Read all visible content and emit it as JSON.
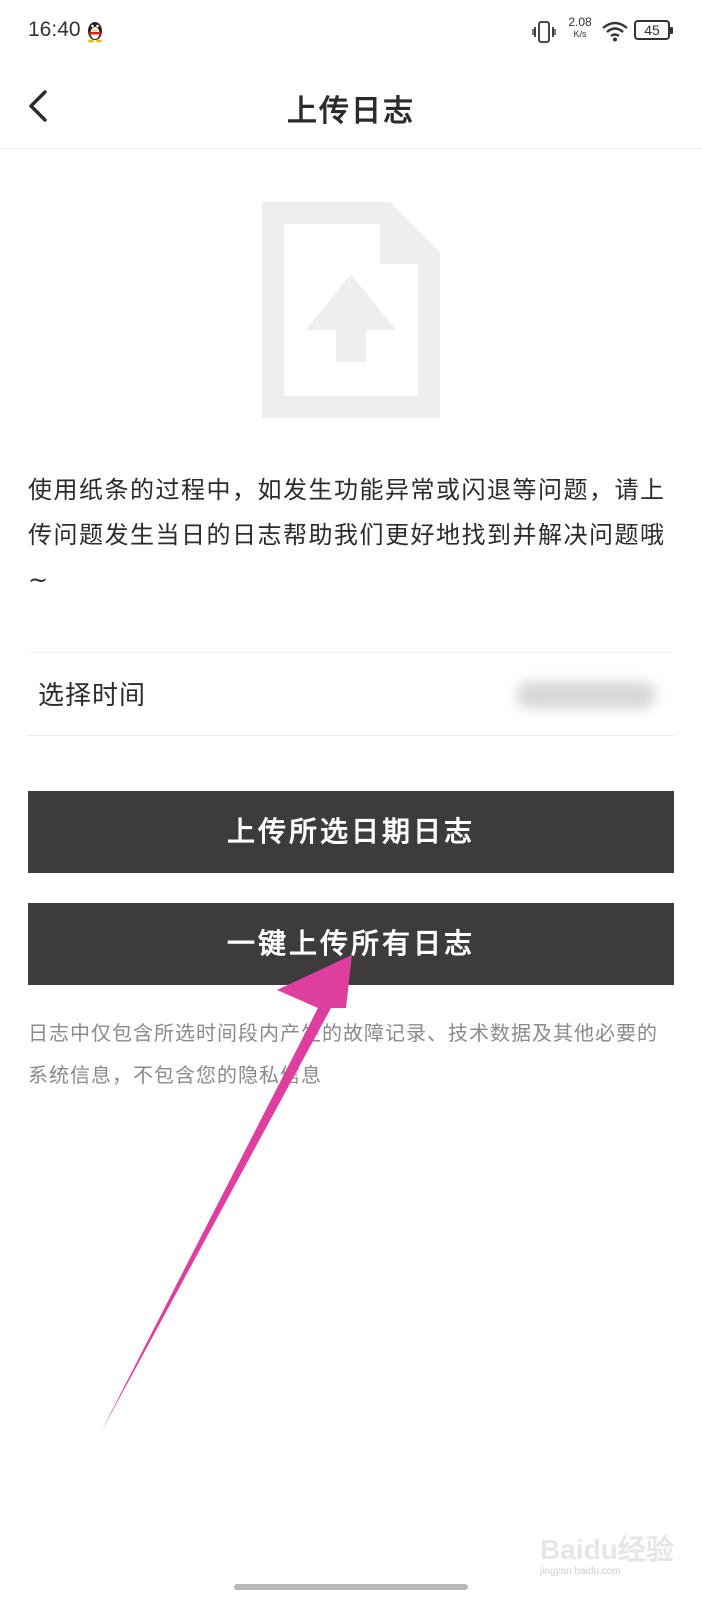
{
  "status_bar": {
    "time": "16:40",
    "net_speed_value": "2.08",
    "net_speed_unit": "K/s",
    "battery_level": "45",
    "icons": [
      "qq-penguin-icon",
      "vibrate-icon",
      "wifi-icon",
      "battery-icon"
    ]
  },
  "header": {
    "title": "上传日志",
    "back_icon": "chevron-left-icon"
  },
  "illustration": {
    "icon": "file-upload-icon",
    "color": "#eeeeee"
  },
  "description": "使用纸条的过程中，如发生功能异常或闪退等问题，请上传问题发生当日的日志帮助我们更好地找到并解决问题哦~",
  "time_selector": {
    "label": "选择时间"
  },
  "buttons": {
    "upload_selected": "上传所选日期日志",
    "upload_all": "一键上传所有日志"
  },
  "note": "日志中仅包含所选时间段内产生的故障记录、技术数据及其他必要的系统信息，不包含您的隐私信息",
  "watermark": {
    "brand": "Baidu经验",
    "url": "jingyan.baidu.com"
  },
  "colors": {
    "button_bg": "#3d3b3c",
    "button_text": "#ffffff",
    "annotation_arrow": "#de3f9e",
    "note_text": "#8a8a8a"
  }
}
